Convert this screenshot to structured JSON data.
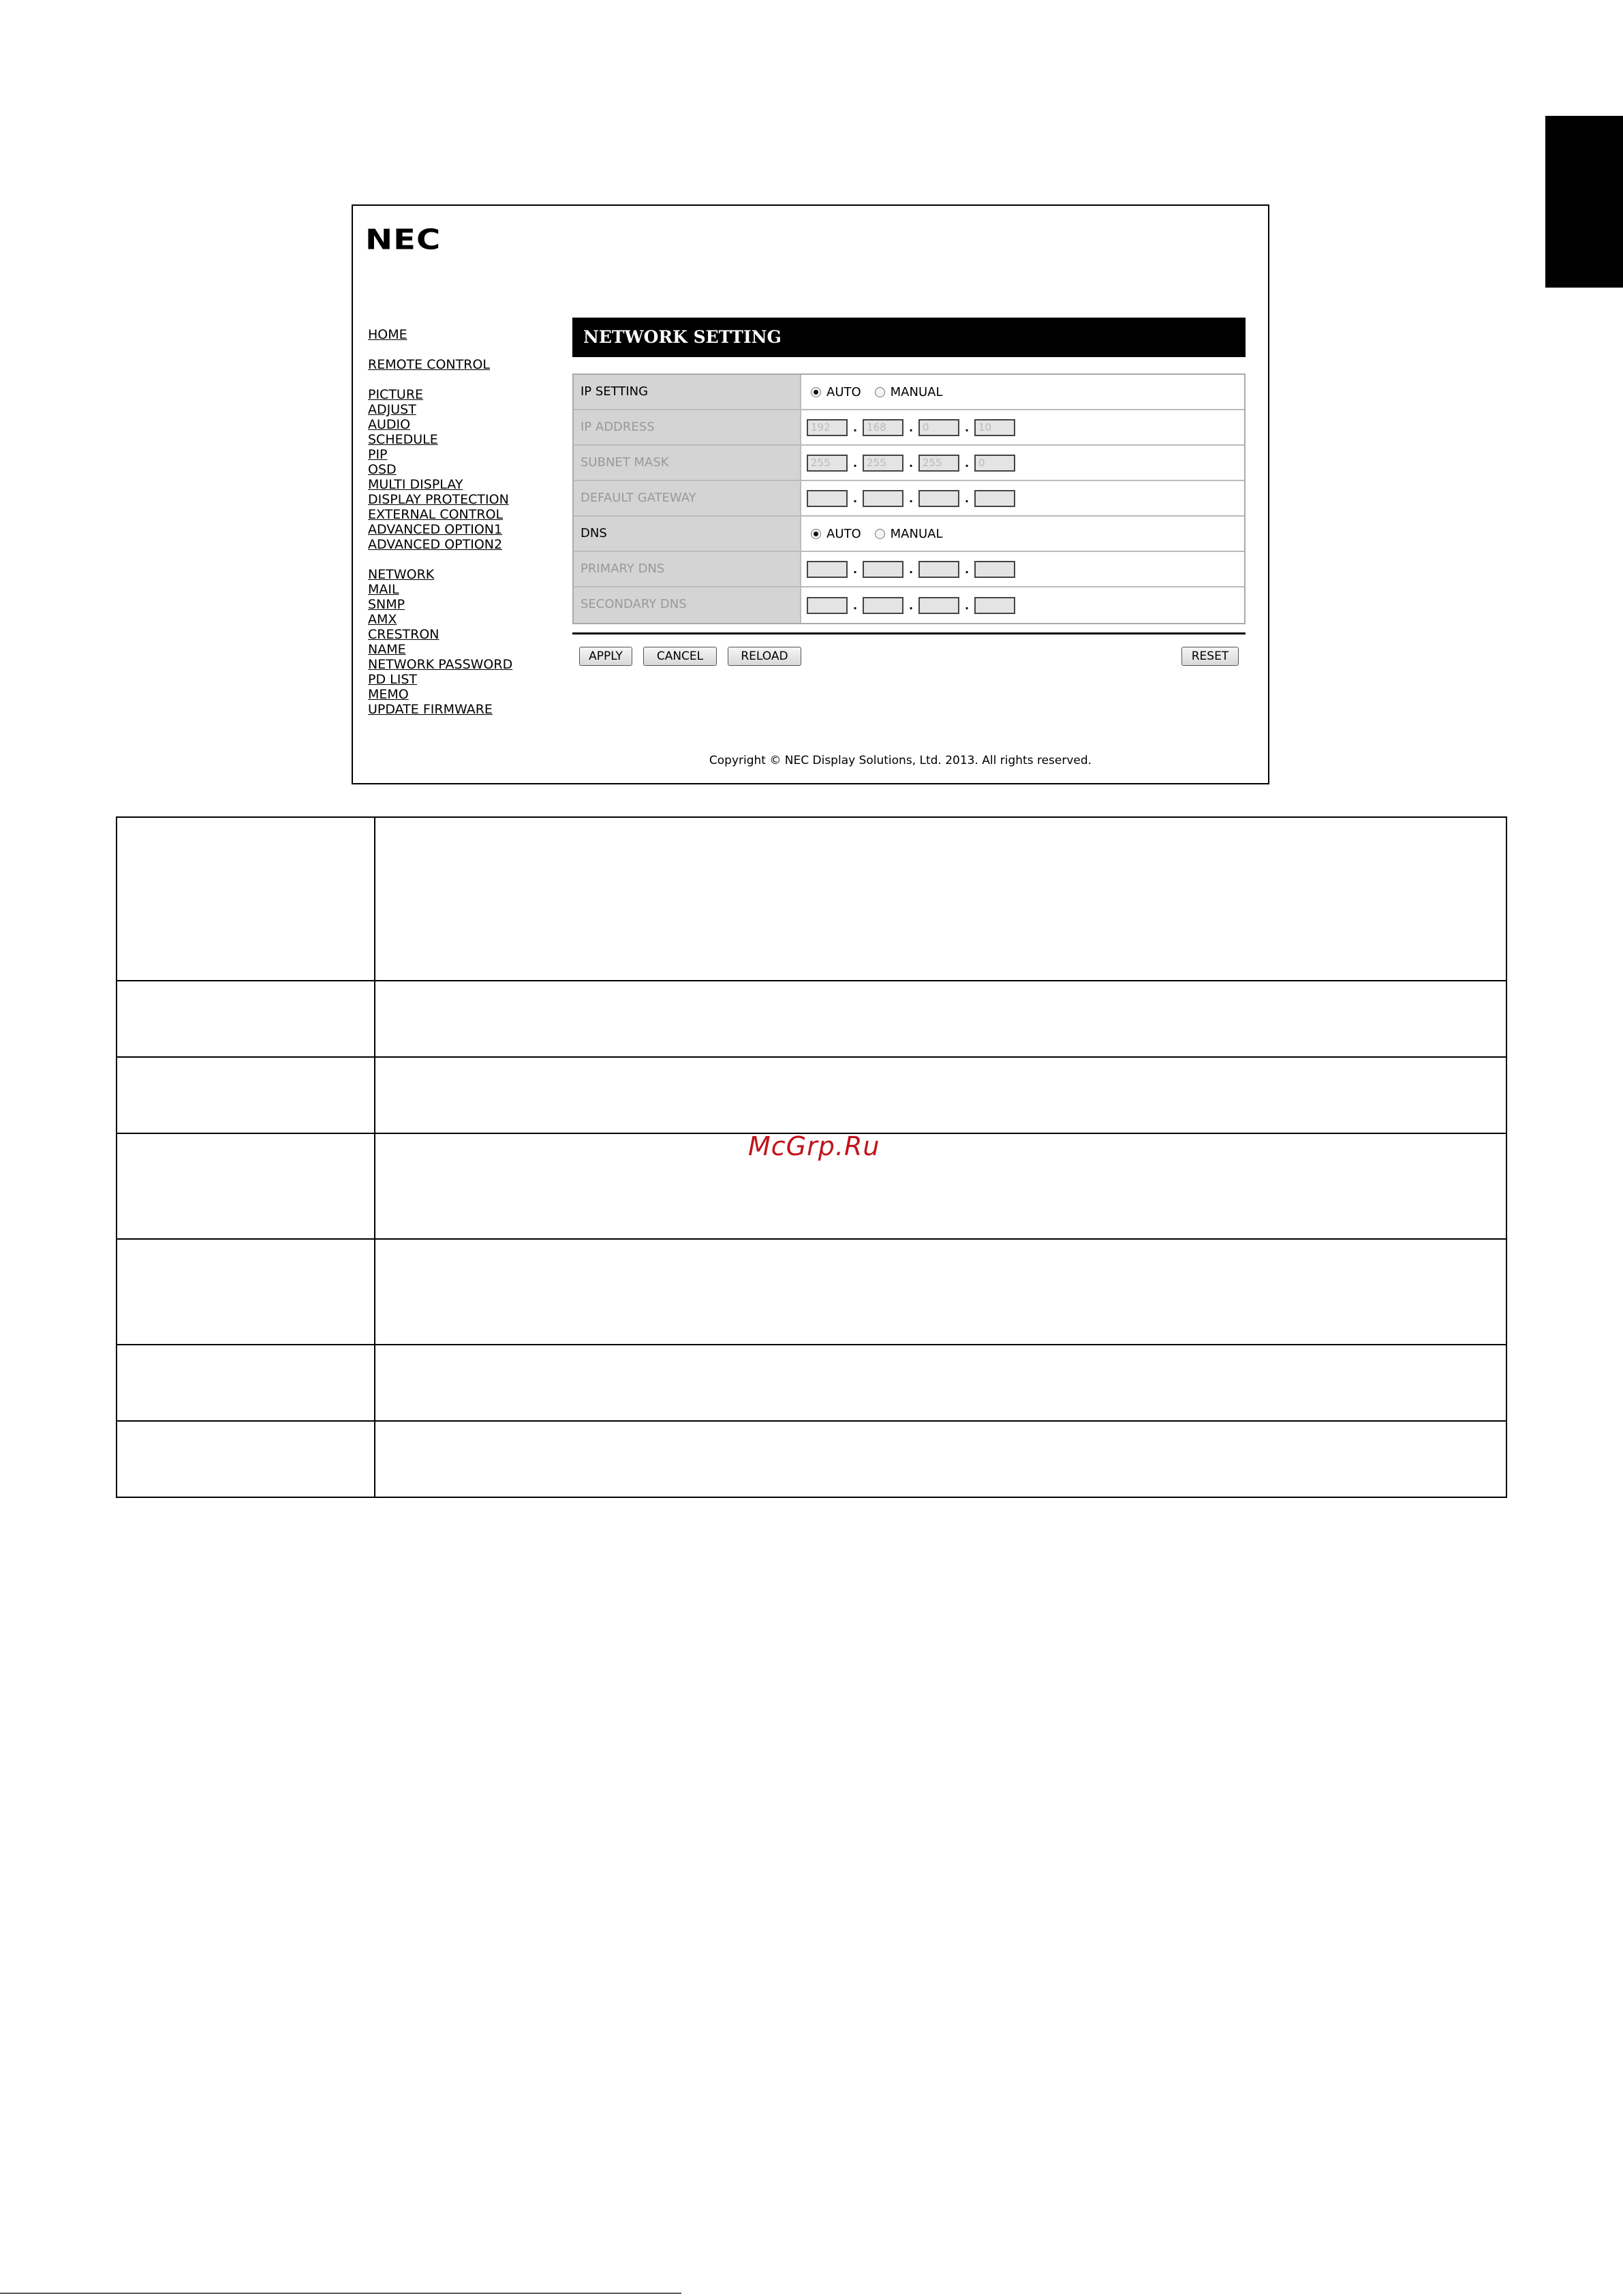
{
  "logo_text": "NEC",
  "nav_groups": [
    [
      "HOME"
    ],
    [
      "REMOTE CONTROL"
    ],
    [
      "PICTURE",
      "ADJUST",
      "AUDIO",
      "SCHEDULE",
      "PIP",
      "OSD",
      "MULTI DISPLAY",
      "DISPLAY PROTECTION",
      "EXTERNAL CONTROL",
      "ADVANCED OPTION1",
      "ADVANCED OPTION2"
    ],
    [
      "NETWORK",
      "MAIL",
      "SNMP",
      "AMX",
      "CRESTRON",
      "NAME",
      "NETWORK PASSWORD",
      "PD LIST",
      "MEMO",
      "UPDATE FIRMWARE"
    ]
  ],
  "section_title": "NETWORK SETTING",
  "rows": {
    "ip_setting": {
      "label": "IP SETTING",
      "auto": "AUTO",
      "manual": "MANUAL",
      "selected": "AUTO"
    },
    "ip_address": {
      "label": "IP ADDRESS",
      "octets": [
        "192",
        "168",
        "0",
        "10"
      ]
    },
    "subnet_mask": {
      "label": "SUBNET MASK",
      "octets": [
        "255",
        "255",
        "255",
        "0"
      ]
    },
    "default_gateway": {
      "label": "DEFAULT GATEWAY",
      "octets": [
        "",
        "",
        "",
        ""
      ]
    },
    "dns": {
      "label": "DNS",
      "auto": "AUTO",
      "manual": "MANUAL",
      "selected": "AUTO"
    },
    "primary_dns": {
      "label": "PRIMARY DNS",
      "octets": [
        "",
        "",
        "",
        ""
      ]
    },
    "secondary_dns": {
      "label": "SECONDARY DNS",
      "octets": [
        "",
        "",
        "",
        ""
      ]
    }
  },
  "buttons": {
    "apply": "APPLY",
    "cancel": "CANCEL",
    "reload": "RELOAD",
    "reset": "RESET"
  },
  "copyright": "Copyright © NEC Display Solutions, Ltd. 2013. All rights reserved.",
  "watermark": "McGrp.Ru"
}
